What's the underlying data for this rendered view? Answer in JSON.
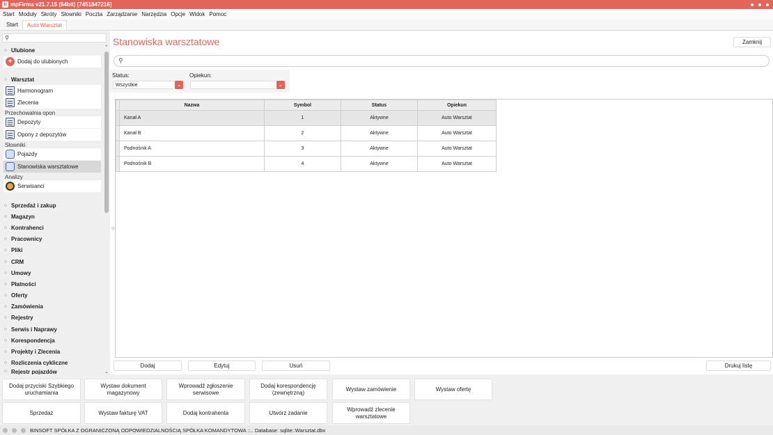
{
  "window": {
    "title": "mpFirma v21.7.15 (64bit) [7451847216]"
  },
  "menu": [
    "Start",
    "Moduły",
    "Skróty",
    "Słowniki",
    "Poczta",
    "Zarządzanie",
    "Narzędzia",
    "Opcje",
    "Widok",
    "Pomoc"
  ],
  "tabs": [
    {
      "label": "Start",
      "active": false
    },
    {
      "label": "Auto Warsztat",
      "active": true
    }
  ],
  "sidebar": {
    "favorites": {
      "title": "Ulubione",
      "add_label": "Dodaj do ulubionych"
    },
    "workshop": {
      "title": "Warsztat",
      "items": [
        "Harmonogram",
        "Zlecenia"
      ],
      "storage_label": "Przechowalnia opon",
      "storage_items": [
        "Depozyty",
        "Opony z depozytów"
      ],
      "dict_label": "Słowniki",
      "dict_items": [
        "Pojazdy",
        "Stanowiska warsztatowe"
      ],
      "analysis_label": "Analizy",
      "analysis_items": [
        "Serwisanci"
      ]
    },
    "sections": [
      "Sprzedaż i zakup",
      "Magazyn",
      "Kontrahenci",
      "Pracownicy",
      "Pliki",
      "CRM",
      "Umowy",
      "Płatności",
      "Oferty",
      "Zamówienia",
      "Rejestry",
      "Serwis i Naprawy",
      "Korespondencja",
      "Projekty i Zlecenia",
      "Rozliczenia cykliczne",
      "Rejestr pojazdów"
    ]
  },
  "main": {
    "title": "Stanowiska warsztatowe",
    "close_label": "Zamknij",
    "filters": {
      "status_label": "Status:",
      "status_value": "Wszystkie",
      "owner_label": "Opiekun:",
      "owner_value": ""
    },
    "table": {
      "columns": [
        "Nazwa",
        "Symbol",
        "Status",
        "Opiekun"
      ],
      "rows": [
        [
          "Kanał A",
          "1",
          "Aktywne",
          "Auto Warsztat"
        ],
        [
          "Kanał B",
          "2",
          "Aktywne",
          "Auto Warsztat"
        ],
        [
          "Podnośnik A",
          "3",
          "Aktywne",
          "Auto Warsztat"
        ],
        [
          "Podnośnik B",
          "4",
          "Aktywne",
          "Auto Warsztat"
        ]
      ]
    },
    "actions": {
      "add": "Dodaj",
      "edit": "Edytuj",
      "delete": "Usuń",
      "print": "Drukuj listę"
    }
  },
  "quick_actions": {
    "row1": [
      "Dodaj przyciski Szybkiego uruchamiania",
      "Wystaw dokument magazynowy",
      "Wprowadź zgłoszenie serwisowe",
      "Dodaj korespondencję (zewnętrzną)",
      "Wystaw zamówienie",
      "Wystaw ofertę"
    ],
    "row2": [
      "Sprzedaż",
      "Wystaw fakturę VAT",
      "Dodaj kontrahenta",
      "Utwórz zadanie",
      "Wprowadź zlecenie warsztatowe"
    ]
  },
  "status_bar": {
    "text": "BINSOFT SPÓŁKA Z OGRANICZONĄ ODPOWIEDZIALNOŚCIĄ SPÓŁKA KOMANDYTOWA ::.. Database: sqlite::Warsztat.dbx"
  },
  "colors": {
    "accent": "#e3645b",
    "selected_row": "#e6e6e6"
  }
}
